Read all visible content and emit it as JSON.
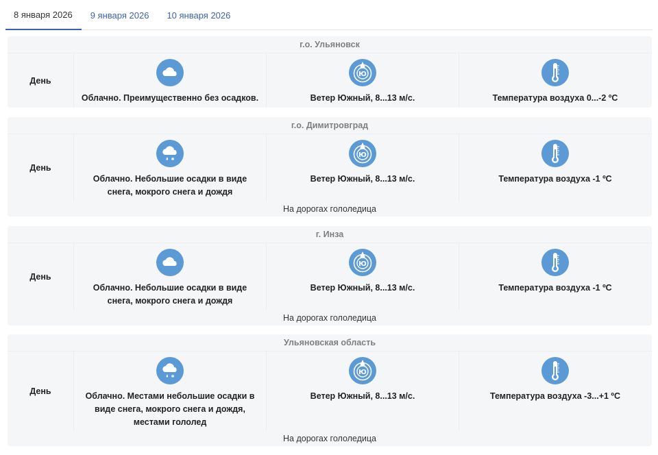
{
  "tabs": [
    {
      "label": "8 января 2026",
      "active": true
    },
    {
      "label": "9 января 2026",
      "active": false
    },
    {
      "label": "10 января 2026",
      "active": false
    }
  ],
  "colors": {
    "icon_blue": "#5b9ad5",
    "tab_active": "#3b62b0",
    "card_bg": "#f5f6f7"
  },
  "cards": [
    {
      "title": "г.о. Ульяновск",
      "period": "День",
      "cloud_icon": "cloud-icon",
      "cloud": "Облачно. Преимущественно без осадков.",
      "wind_icon": "wind-south-icon",
      "wind_dir_letter": "Ю",
      "wind": "Ветер Южный, 8...13 м/с.",
      "temp_icon": "thermometer-icon",
      "temp": "Температура воздуха 0...-2 ºC",
      "note": ""
    },
    {
      "title": "г.о. Димитровград",
      "period": "День",
      "cloud_icon": "cloud-rain-snow-icon",
      "cloud": "Облачно. Небольшие осадки в виде снега, мокрого снега и дождя",
      "wind_icon": "wind-south-icon",
      "wind_dir_letter": "Ю",
      "wind": "Ветер Южный, 8...13 м/с.",
      "temp_icon": "thermometer-icon",
      "temp": "Температура воздуха -1 ºC",
      "note": "На дорогах гололедица"
    },
    {
      "title": "г. Инза",
      "period": "День",
      "cloud_icon": "cloud-icon",
      "cloud": "Облачно. Небольшие осадки в виде снега, мокрого снега и дождя",
      "wind_icon": "wind-south-icon",
      "wind_dir_letter": "Ю",
      "wind": "Ветер Южный, 8...13 м/с.",
      "temp_icon": "thermometer-icon",
      "temp": "Температура воздуха -1 ºC",
      "note": "На дорогах гололедица"
    },
    {
      "title": "Ульяновская область",
      "period": "День",
      "cloud_icon": "cloud-rain-snow-icon",
      "cloud": "Облачно. Местами небольшие осадки в виде снега, мокрого снега и дождя, местами гололед",
      "wind_icon": "wind-south-icon",
      "wind_dir_letter": "Ю",
      "wind": "Ветер Южный, 8...13 м/с.",
      "temp_icon": "thermometer-icon",
      "temp": "Температура воздуха -3...+1 ºC",
      "note": "На дорогах гололедица"
    }
  ]
}
